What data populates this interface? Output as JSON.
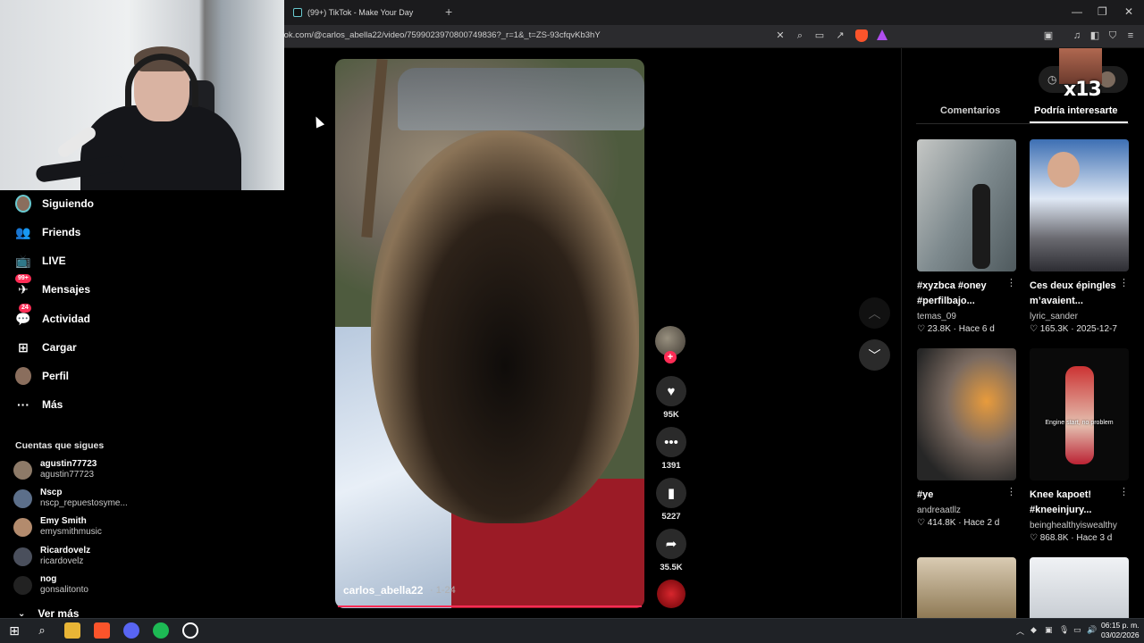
{
  "browser": {
    "tab_title": "(99+) TikTok - Make Your Day",
    "new_tab": "+",
    "url": "tok.com/@carlos_abella22/video/7599023970800749836?_r=1&_t=ZS-93cfqvKb3hY",
    "win_min": "—",
    "win_restore": "❐",
    "win_close": "✕"
  },
  "sidebar": {
    "nav": [
      {
        "label": "Siguiendo",
        "icon": "avatar"
      },
      {
        "label": "Friends",
        "icon": "friends-icon"
      },
      {
        "label": "LIVE",
        "icon": "live-icon"
      },
      {
        "label": "Mensajes",
        "icon": "messages-icon",
        "badge": "99+"
      },
      {
        "label": "Actividad",
        "icon": "activity-icon",
        "badge": "24"
      },
      {
        "label": "Cargar",
        "icon": "upload-icon"
      },
      {
        "label": "Perfil",
        "icon": "avatar"
      },
      {
        "label": "Más",
        "icon": "more-icon"
      }
    ],
    "following_title": "Cuentas que sigues",
    "accounts": [
      {
        "name": "agustin77723",
        "handle": "agustin77723",
        "color": "#8d7a68"
      },
      {
        "name": "Nscp",
        "handle": "nscp_repuestosyme...",
        "color": "#5c6f8a"
      },
      {
        "name": "Emy Smith",
        "handle": "emysmithmusic",
        "color": "#b38b6d"
      },
      {
        "name": "Ricardovelz",
        "handle": "ricardovelz",
        "color": "#4a4f5c"
      },
      {
        "name": "nog",
        "handle": "gonsalitonto",
        "color": "#222222"
      }
    ],
    "see_more": "Ver más"
  },
  "video": {
    "author": "carlos_abella22",
    "date": "· 1-24",
    "likes": "95K",
    "comments": "1391",
    "saves": "5227",
    "shares": "35.5K"
  },
  "right_panel": {
    "overlay_text": "x13",
    "tabs": [
      "Comentarios",
      "Podría interesarte"
    ],
    "cards": [
      {
        "title": "#xyzbca #oney #perfilbajo...",
        "user": "temas_09",
        "likes": "23.8K",
        "date": "Hace 6 d",
        "thumb_text": ""
      },
      {
        "title": "Ces deux épingles m’avaient...",
        "user": "lyric_sander",
        "likes": "165.3K",
        "date": "2025-12-7",
        "thumb_text": ""
      },
      {
        "title": "#ye",
        "user": "andreaatllz",
        "likes": "414.8K",
        "date": "Hace 2 d",
        "thumb_text": ""
      },
      {
        "title": "Knee kapoet! #kneeinjury...",
        "user": "beinghealthyiswealthy",
        "likes": "868.8K",
        "date": "Hace 3 d",
        "thumb_text": "Engine start, no problem"
      }
    ]
  },
  "taskbar": {
    "time": "06:15 p. m.",
    "date": "03/02/2026"
  }
}
